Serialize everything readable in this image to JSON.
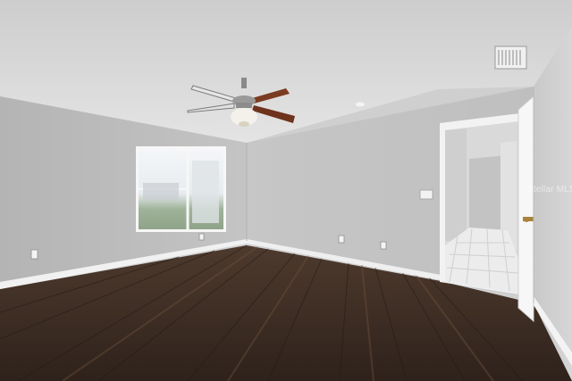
{
  "scene": {
    "description_type": "empty-room-photo",
    "watermark_text": "Stellar MLS",
    "colors": {
      "ceiling": "#d9d9d9",
      "left_wall": "#bdbdbd",
      "back_wall": "#c7c7c7",
      "right_wall": "#cbcbcb",
      "floor_dark": "#3a2b22",
      "floor_mid": "#5a4232",
      "baseboard": "#f2f2f2",
      "hall_floor": "#e9e9e9"
    }
  }
}
